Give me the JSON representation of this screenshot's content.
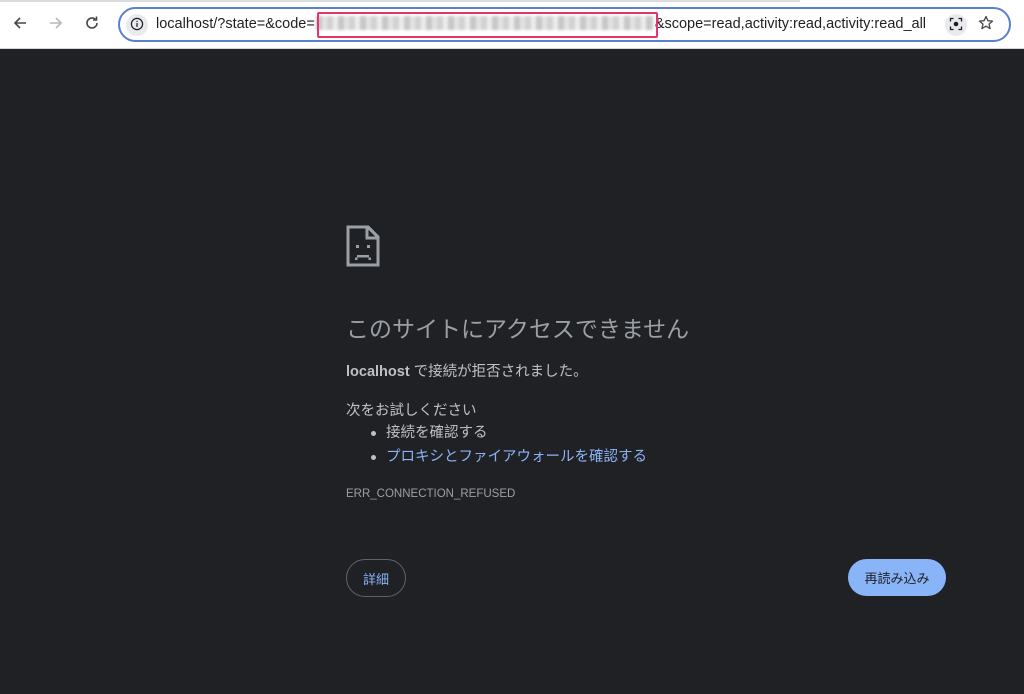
{
  "browser": {
    "url_before_redaction": "localhost/?state=&code=",
    "url_after_redaction": "&scope=read,activity:read,activity:read_all",
    "icons": {
      "back": "arrow-back-icon",
      "forward": "arrow-forward-icon",
      "reload": "reload-icon",
      "site_info": "info-icon",
      "lens": "lens-icon",
      "bookmark": "star-icon"
    }
  },
  "error_page": {
    "icon": "sad-page-icon",
    "title": "このサイトにアクセスできません",
    "host": "localhost",
    "description_rest": " で接続が拒否されました。",
    "suggestions_heading": "次をお試しください",
    "suggestion_1": "接続を確認する",
    "suggestion_2": "プロキシとファイアウォールを確認する",
    "error_code": "ERR_CONNECTION_REFUSED",
    "details_label": "詳細",
    "reload_label": "再読み込み"
  },
  "colors": {
    "page_background": "#202124",
    "link": "#8ab4f8",
    "highlight_box": "#e6336b"
  }
}
